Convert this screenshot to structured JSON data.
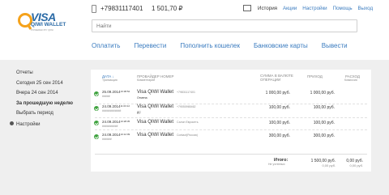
{
  "header": {
    "logo_visa": "VISA",
    "logo_qiwi": "QIWI WALLET",
    "logo_tagline": "POWERED BY QIWI",
    "phone": "+79831117401",
    "balance": "1 501,70 ₽",
    "nav": [
      {
        "label": "История",
        "active": true
      },
      {
        "label": "Акции",
        "active": false
      },
      {
        "label": "Настройки",
        "active": false
      },
      {
        "label": "Помощь",
        "active": false
      },
      {
        "label": "Выход",
        "active": false
      }
    ],
    "search_placeholder": "Найти",
    "actions": [
      "Оплатить",
      "Перевести",
      "Пополнить кошелек",
      "Банковские карты",
      "Вывести"
    ]
  },
  "sidebar": {
    "items": [
      {
        "label": "Отчеты",
        "bold": false
      },
      {
        "label": "Сегодня 25 сен 2014",
        "bold": false
      },
      {
        "label": "Вчера 24 сен 2014",
        "bold": false
      },
      {
        "label": "За прошедшую неделю",
        "bold": true
      },
      {
        "label": "Выбрать период",
        "bold": false
      },
      {
        "label": "Настройки",
        "bold": false
      }
    ]
  },
  "table": {
    "headers": {
      "date": "ДАТА ↓",
      "date_sub": "Транзакция",
      "provider": "ПРОВАЙДЕР НОМЕР",
      "provider_sub": "Комментарий",
      "amount_op": "СУММА В ВАЛЮТЕ ОПЕРАЦИИ",
      "income": "ПРИХОД",
      "expense": "РАСХОД",
      "expense_sub": "Комиссия"
    },
    "rows": [
      {
        "date": "25.09.2014",
        "time": "16:38:52",
        "txn": "#####",
        "provider": "Visa QIWI Wallet",
        "number": "+79831117401",
        "comment": "Отмена",
        "amount_op": "1 000,00 руб.",
        "income": "1 000,00 руб.",
        "expense": ""
      },
      {
        "date": "24.09.2014",
        "time": "11:03:12",
        "txn": "############",
        "provider": "Visa QIWI Wallet",
        "number": "+79050965462",
        "comment": "ДС",
        "amount_op": "100,00 руб.",
        "income": "100,00 руб.",
        "expense": ""
      },
      {
        "date": "24.09.2014",
        "time": "10:28:35",
        "txn": "##########",
        "provider": "Visa QIWI Wallet",
        "number": "Салон Евросеть",
        "comment": "",
        "amount_op": "100,00 руб.",
        "income": "100,00 руб.",
        "expense": ""
      },
      {
        "date": "24.09.2014",
        "time": "10:12:09",
        "txn": "######",
        "provider": "Visa QIWI Wallet",
        "number": "Contact(Россия)",
        "comment": "",
        "amount_op": "300,00 руб.",
        "income": "300,00 руб.",
        "expense": ""
      }
    ],
    "totals": {
      "label": "Итого:",
      "sub": "Не учтенных",
      "income": "1 500,00 руб.",
      "income_sub": "0,00 руб.",
      "expense": "0,00 руб.",
      "expense_sub": "0,00 руб."
    }
  },
  "colors": {
    "accent": "#3a7bbf",
    "success": "#3fa33f",
    "background": "#efefef"
  }
}
